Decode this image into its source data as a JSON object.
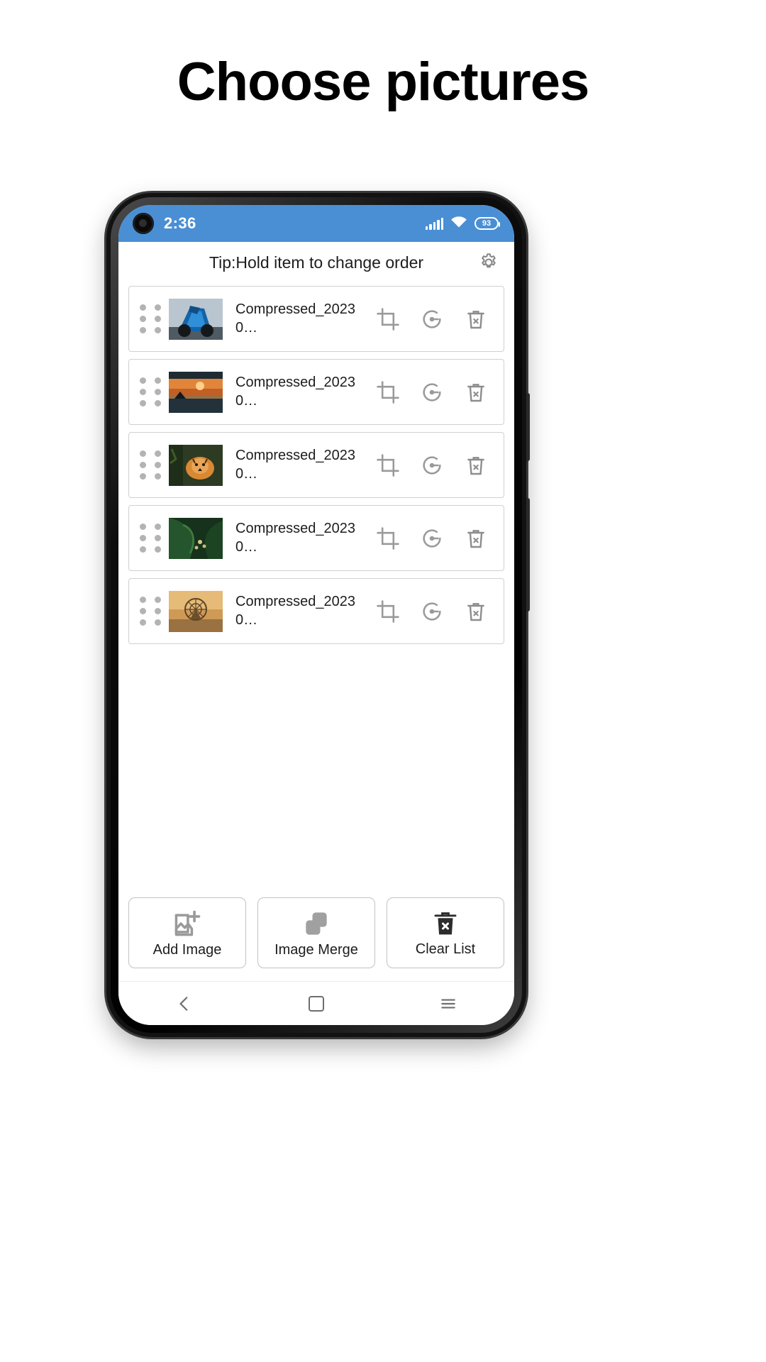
{
  "page": {
    "title": "Choose pictures"
  },
  "status_bar": {
    "time": "2:36",
    "signal_icon": "signal-bars-icon",
    "wifi_icon": "wifi-icon",
    "battery_icon": "battery-icon",
    "battery_level": "93",
    "background_color": "#4a8fd4"
  },
  "app_bar": {
    "tip": "Tip:Hold item to change order",
    "settings_icon": "gear-icon"
  },
  "list": {
    "drag_handle_icon": "drag-dots-icon",
    "crop_icon": "crop-icon",
    "rotate_icon": "rotate-icon",
    "delete_icon": "trash-delete-icon",
    "items": [
      {
        "name": "Compressed_20230…",
        "thumb": "motorcycle-thumbnail"
      },
      {
        "name": "Compressed_20230…",
        "thumb": "sunset-lake-thumbnail"
      },
      {
        "name": "Compressed_20230…",
        "thumb": "tiger-thumbnail"
      },
      {
        "name": "Compressed_20230…",
        "thumb": "green-leaves-thumbnail"
      },
      {
        "name": "Compressed_20230…",
        "thumb": "ferris-wheel-thumbnail"
      }
    ]
  },
  "bottom_actions": [
    {
      "label": "Add Image",
      "icon": "add-image-icon"
    },
    {
      "label": "Image Merge",
      "icon": "merge-squares-icon"
    },
    {
      "label": "Clear List",
      "icon": "clear-list-trash-icon"
    }
  ],
  "nav_bar": {
    "back_icon": "back-chevron-icon",
    "home_icon": "home-square-icon",
    "recents_icon": "recents-menu-icon"
  },
  "colors": {
    "accent": "#4a8fd4",
    "icon_gray": "#909090",
    "border": "#d0d0d0"
  }
}
